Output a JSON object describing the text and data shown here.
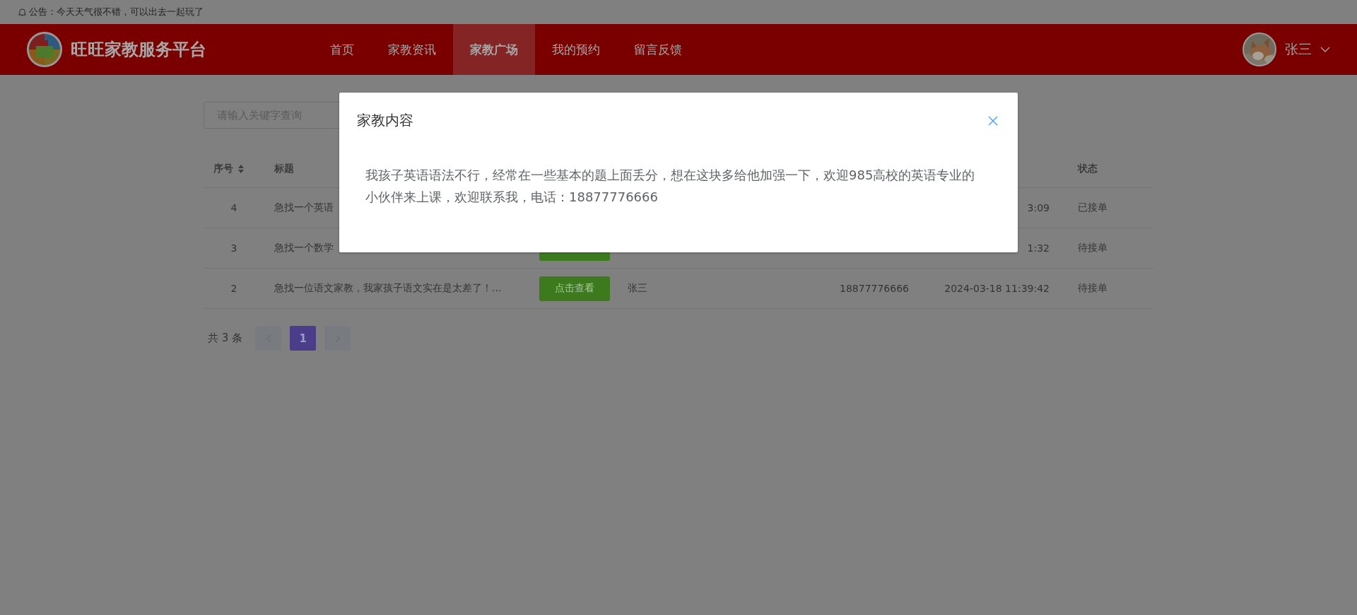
{
  "notice": {
    "text": "公告：今天天气很不错，可以出去一起玩了"
  },
  "header": {
    "title": "旺旺家教服务平台",
    "nav": [
      {
        "label": "首页",
        "selected": false
      },
      {
        "label": "家教资讯",
        "selected": false
      },
      {
        "label": "家教广场",
        "selected": true
      },
      {
        "label": "我的预约",
        "selected": false
      },
      {
        "label": "留言反馈",
        "selected": false
      }
    ],
    "user": {
      "name": "张三"
    }
  },
  "search": {
    "placeholder": "请输入关键字查询"
  },
  "table": {
    "columns": [
      {
        "label": "序号",
        "sortable": true
      },
      {
        "label": "标题",
        "sortable": false
      },
      {
        "label": "状态",
        "sortable": false
      }
    ],
    "rows": [
      {
        "index": "4",
        "title": "急找一个英语",
        "time": "3:09",
        "status": "已接单"
      },
      {
        "index": "3",
        "title": "急找一个数学",
        "action": true,
        "time": "1:32",
        "status": "待接单"
      },
      {
        "index": "2",
        "title": "急找一位语文家教，我家孩子语文实在是太差了！...",
        "action": true,
        "button": "点击查看",
        "name": "张三",
        "phone": "18877776666",
        "time": "2024-03-18 11:39:42",
        "status": "待接单"
      }
    ]
  },
  "pagination": {
    "total": "共 3 条",
    "pages": [
      {
        "label": "1",
        "selected": true
      }
    ]
  },
  "dialog": {
    "title": "家教内容",
    "body": "我孩子英语语法不行，经常在一些基本的题上面丢分，想在这块多给他加强一下，欢迎985高校的英语专业的小伙伴来上课，欢迎联系我，电话：18877776666"
  }
}
